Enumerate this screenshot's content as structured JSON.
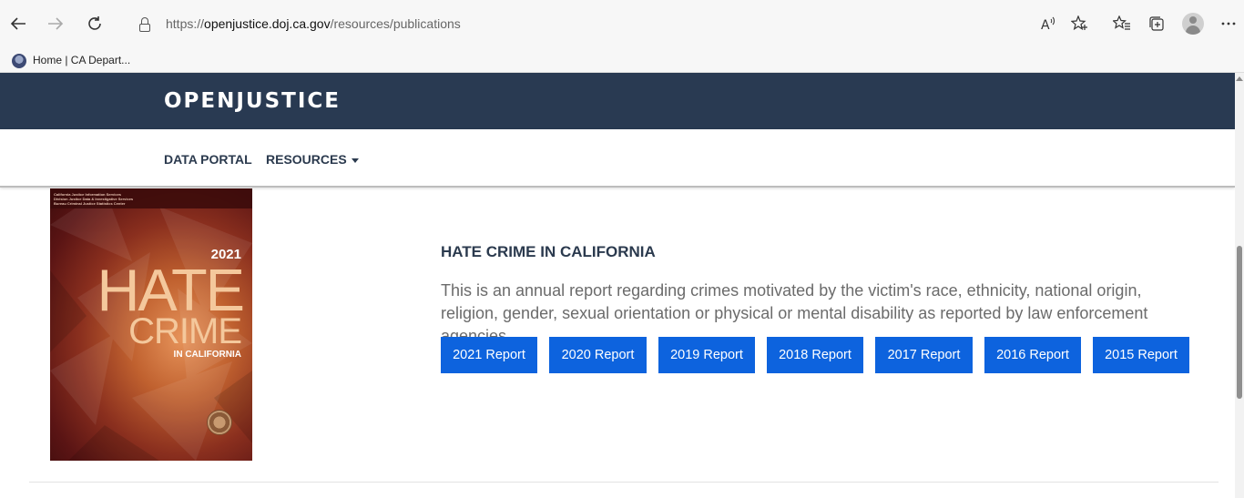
{
  "browser": {
    "url_prefix": "https://",
    "url_host": "openjustice.doj.ca.gov",
    "url_path": "/resources/publications",
    "favorite_label": "Home | CA Depart..."
  },
  "site": {
    "logo_text": "OPENJUSTICE",
    "nav": {
      "data_portal": "DATA PORTAL",
      "resources": "RESOURCES"
    }
  },
  "publication": {
    "title": "HATE CRIME IN CALIFORNIA",
    "description": "This is an annual report regarding crimes motivated by the victim's race, ethnicity, national origin, religion, gender, sexual orientation or physical or mental disability as reported by law enforcement agencies.",
    "cover": {
      "header_text": "California Justice Information Services Division Justice Data & Investigative Services Bureau Criminal Justice Statistics Center",
      "year": "2021",
      "word1": "HATE",
      "word2": "CRIME",
      "subtitle": "IN CALIFORNIA"
    },
    "reports": [
      "2021 Report",
      "2020 Report",
      "2019 Report",
      "2018 Report",
      "2017 Report",
      "2016 Report",
      "2015 Report"
    ]
  },
  "colors": {
    "header_bg": "#293a52",
    "button_bg": "#0d63de",
    "nav_text": "#2b3a4e"
  }
}
